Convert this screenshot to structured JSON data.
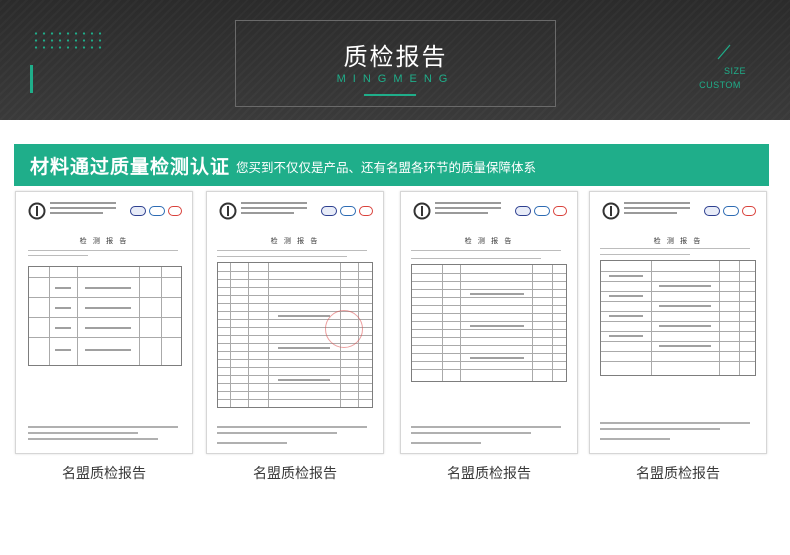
{
  "header": {
    "title": "质检报告",
    "subtitle": "MINGMENG",
    "size_label": "SIZE",
    "custom_label": "CUSTOM"
  },
  "banner": {
    "title": "材料通过质量检测认证",
    "subtitle": "您买到不仅仅是产品、还有名盟各环节的质量保障体系"
  },
  "reports": [
    {
      "heading": "检 测 报 告",
      "caption": "名盟质检报告",
      "badge": "MA"
    },
    {
      "heading": "检 测 报 告",
      "caption": "名盟质检报告",
      "badge": "MA"
    },
    {
      "heading": "检 测 报 告",
      "caption": "名盟质检报告",
      "badge": "MA"
    },
    {
      "heading": "检 测 报 告",
      "caption": "名盟质检报告",
      "badge": "MA"
    }
  ],
  "colors": {
    "accent": "#1fae8a",
    "header_bg": "#2f2f2f"
  }
}
